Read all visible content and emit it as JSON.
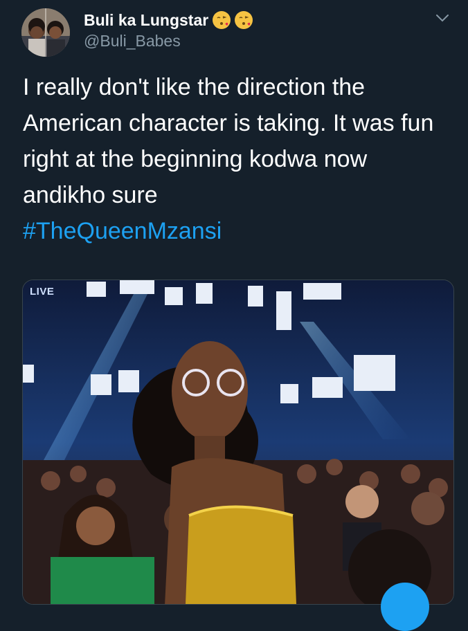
{
  "tweet": {
    "display_name": "Buli ka Lungstar",
    "handle": "@Buli_Babes",
    "text": "I really don't like the direction the American character is taking. It was fun right at the beginning kodwa now andikho sure",
    "hashtag": "#TheQueenMzansi",
    "name_emojis": [
      "face-blowing-kiss-emoji",
      "face-blowing-kiss-emoji"
    ]
  },
  "media": {
    "live_label": "LIVE"
  },
  "icons": {
    "menu": "chevron-down-icon",
    "fab": "compose-icon"
  },
  "colors": {
    "background": "#15202b",
    "accent": "#1da1f2",
    "secondary_text": "#8899a6"
  }
}
